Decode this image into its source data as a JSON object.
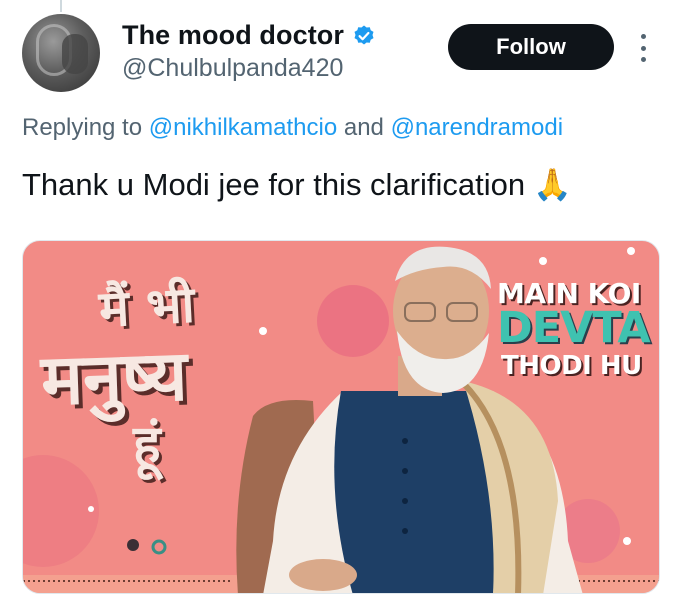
{
  "tweet": {
    "display_name": "The mood doctor",
    "handle": "@Chulbulpanda420",
    "follow_label": "Follow",
    "replying_prefix": "Replying to",
    "replying_to_1": "@nikhilkamathcio",
    "replying_connector": "and",
    "replying_to_2": "@narendramodi",
    "text": "Thank u Modi jee for this clarification",
    "emoji": "🙏"
  },
  "media": {
    "hindi_line_1": "मैं भी",
    "hindi_line_2": "मनुष्य",
    "hindi_line_3": "हूं",
    "right_line_1": "MAIN KOI",
    "right_line_2": "DEVTA",
    "right_line_3": "THODI HU"
  },
  "icons": {
    "verified": "verified-badge-icon",
    "more": "more-options-icon"
  },
  "colors": {
    "follow_bg": "#0f1419",
    "link": "#1d9bf0",
    "secondary_text": "#536471",
    "verified": "#1d9bf0",
    "media_bg": "#f28b86"
  }
}
